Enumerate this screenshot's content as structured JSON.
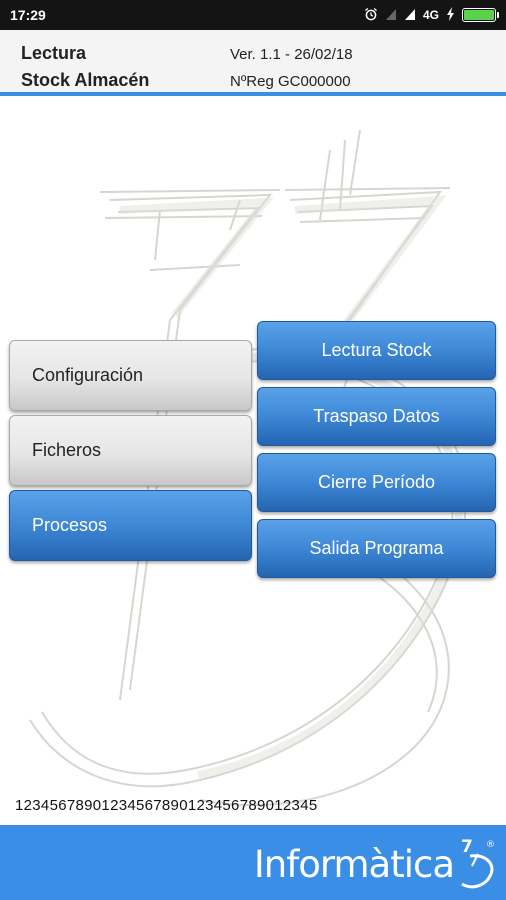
{
  "status_bar": {
    "time": "17:29",
    "network": "4G",
    "icons": [
      "alarm-icon",
      "signal-icon",
      "signal-icon",
      "charging-icon",
      "battery-icon"
    ],
    "battery_color": "#5ad34a"
  },
  "header": {
    "title_line1": "Lectura",
    "title_line2": "Stock Almacén",
    "version": "Ver. 1.1 - 26/02/18",
    "registration": "NºReg GC000000"
  },
  "menu": {
    "left": [
      {
        "label": "Configuración",
        "style": "grey"
      },
      {
        "label": "Ficheros",
        "style": "grey"
      },
      {
        "label": "Procesos",
        "style": "blue",
        "selected": true
      }
    ],
    "right": [
      {
        "label": "Lectura Stock"
      },
      {
        "label": "Traspaso Datos"
      },
      {
        "label": "Cierre Período"
      },
      {
        "label": "Salida Programa"
      }
    ]
  },
  "serial": "12345678901234567890123456789012345",
  "footer": {
    "logo_text": "Informàtica",
    "logo_mark_text": "7",
    "registered": "®",
    "accent_color": "#3a8ee6"
  }
}
